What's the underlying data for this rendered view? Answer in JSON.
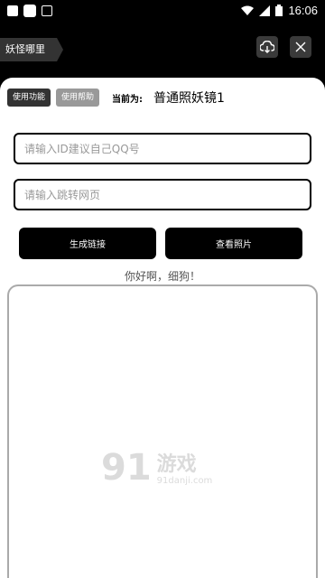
{
  "status_bar": {
    "time": "16:06"
  },
  "app_bar": {
    "title": "妖怪哪里跑"
  },
  "controls": {
    "use_function_label": "使用功能",
    "use_help_label": "使用帮助",
    "current_label": "当前为:",
    "current_value": "普通照妖镜1"
  },
  "form": {
    "id_placeholder": "请输入ID建议自己QQ号",
    "url_placeholder": "请输入跳转网页"
  },
  "buttons": {
    "generate_link": "生成链接",
    "view_photos": "查看照片"
  },
  "greeting": "你好啊，细狗！",
  "watermark": {
    "logo": "91",
    "text": "游戏",
    "site": "91danji.com"
  }
}
